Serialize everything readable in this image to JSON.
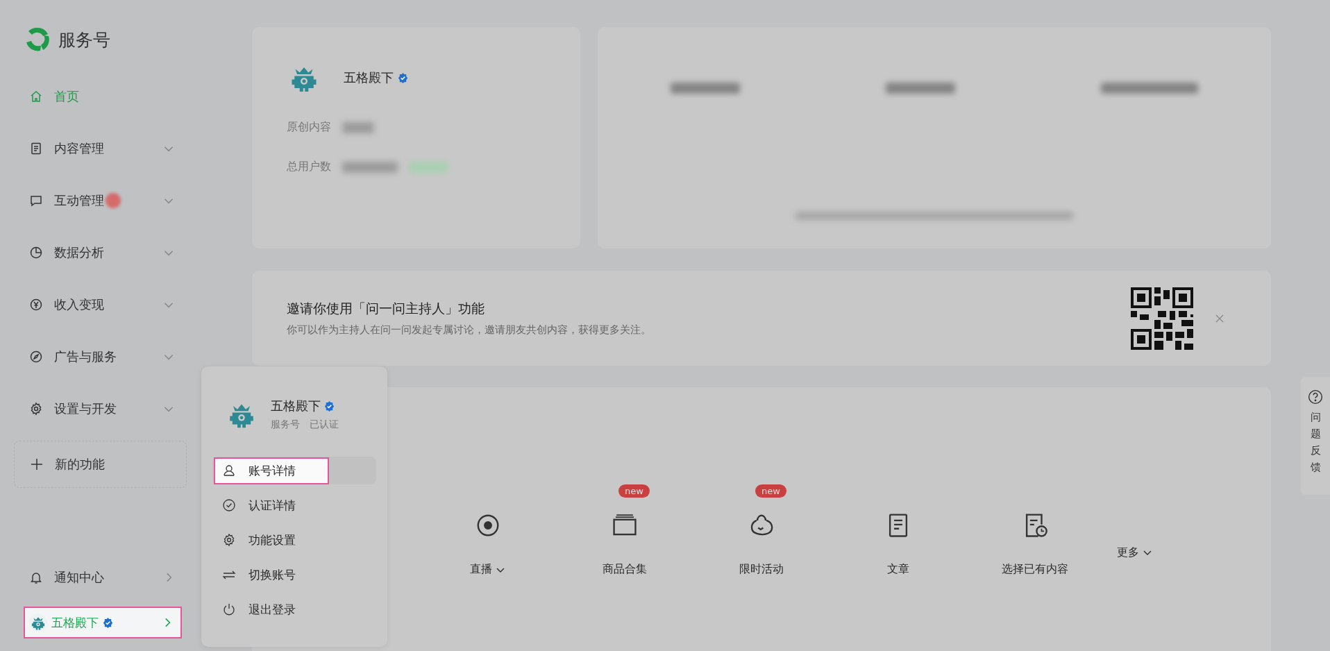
{
  "logo": {
    "text": "服务号"
  },
  "sidebar": {
    "items": [
      {
        "label": "首页",
        "selected": true,
        "expandable": false,
        "badge": false
      },
      {
        "label": "内容管理",
        "selected": false,
        "expandable": true,
        "badge": false
      },
      {
        "label": "互动管理",
        "selected": false,
        "expandable": true,
        "badge": true
      },
      {
        "label": "数据分析",
        "selected": false,
        "expandable": true,
        "badge": false
      },
      {
        "label": "收入变现",
        "selected": false,
        "expandable": true,
        "badge": false
      },
      {
        "label": "广告与服务",
        "selected": false,
        "expandable": true,
        "badge": false
      },
      {
        "label": "设置与开发",
        "selected": false,
        "expandable": true,
        "badge": false
      }
    ],
    "new_feature": "新的功能",
    "notifications": "通知中心",
    "account": {
      "name": "五格殿下",
      "selected": true
    }
  },
  "profile_card": {
    "name": "五格殿下",
    "stats": [
      "原创内容",
      "总用户数"
    ]
  },
  "banner": {
    "title": "邀请你使用「问一问主持人」功能",
    "description": "你可以作为主持人在问一问发起专属讨论，邀请朋友共创内容，获得更多关注。"
  },
  "tools": [
    {
      "label": "直播",
      "dropdown": true
    },
    {
      "label": "商品合集",
      "dropdown": false,
      "badge": "new"
    },
    {
      "label": "限时活动",
      "dropdown": false,
      "badge": "new"
    },
    {
      "label": "文章",
      "dropdown": false
    },
    {
      "label": "选择已有内容",
      "dropdown": false
    }
  ],
  "more": "更多",
  "popup": {
    "name": "五格殿下",
    "type": "服务号",
    "status": "已认证",
    "items": [
      {
        "label": "账号详情",
        "selected": true
      },
      {
        "label": "认证详情",
        "selected": false
      },
      {
        "label": "功能设置",
        "selected": false
      },
      {
        "label": "切换账号",
        "selected": false
      },
      {
        "label": "退出登录",
        "selected": false
      }
    ]
  },
  "feedback": "问题反馈"
}
